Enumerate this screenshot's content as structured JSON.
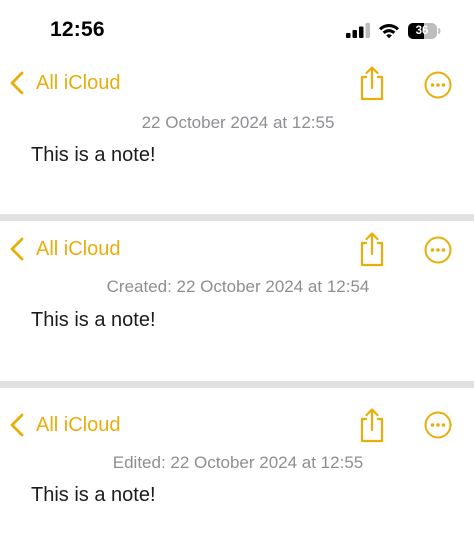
{
  "status_bar": {
    "time": "12:56",
    "battery_level": "36"
  },
  "colors": {
    "accent": "#e9ad0c",
    "secondary_text": "#8e8e93",
    "divider": "#e1e1e1"
  },
  "notes": [
    {
      "back_label": "All iCloud",
      "date": "22 October 2024 at 12:55",
      "body": "This is a note!",
      "icons": [
        "chevron-left-icon",
        "share-icon",
        "more-icon"
      ]
    },
    {
      "back_label": "All iCloud",
      "date": "Created: 22 October 2024 at 12:54",
      "body": "This is a note!",
      "icons": [
        "chevron-left-icon",
        "share-icon",
        "more-icon"
      ]
    },
    {
      "back_label": "All iCloud",
      "date": "Edited: 22 October 2024 at 12:55",
      "body": "This is a note!",
      "icons": [
        "chevron-left-icon",
        "share-icon",
        "more-icon"
      ]
    }
  ]
}
